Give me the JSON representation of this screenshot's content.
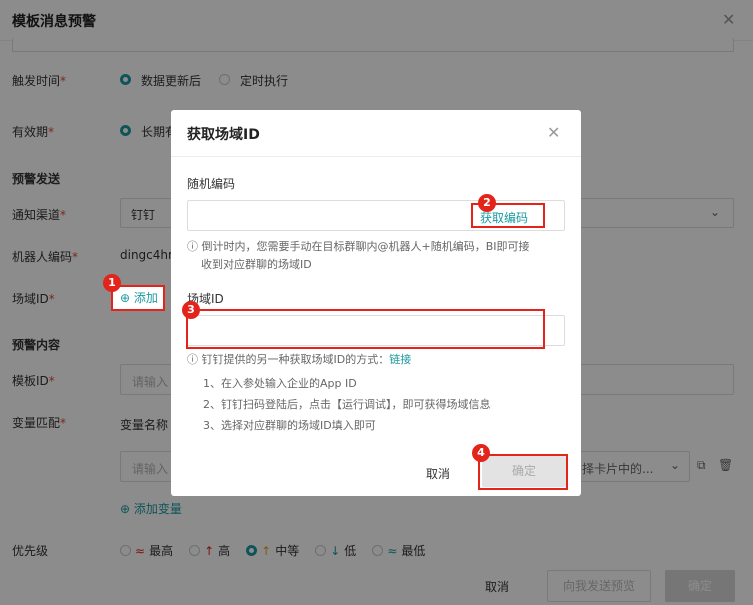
{
  "title": "模板消息预警",
  "form": {
    "trigger_label": "触发时间",
    "trigger_options": [
      "数据更新后",
      "定时执行"
    ],
    "validity_label": "有效期",
    "validity_option": "长期有",
    "section_send": "预警发送",
    "channel_label": "通知渠道",
    "channel_value": "钉钉",
    "robot_label": "机器人编码",
    "robot_value": "dingc4hm",
    "scene_label": "场域ID",
    "add_label": "添加",
    "section_content": "预警内容",
    "template_label": "模板ID",
    "template_placeholder": "请输入",
    "var_label": "变量匹配",
    "var_col_name": "变量名称",
    "var_placeholder": "请输入",
    "var_select_text": "择卡片中的...",
    "add_var_label": "添加变量",
    "priority_label": "优先级",
    "priority_options": [
      {
        "icon": "≈",
        "label": "最高"
      },
      {
        "icon": "↑",
        "label": "高"
      },
      {
        "icon": "↑",
        "label": "中等"
      },
      {
        "icon": "↓",
        "label": "低"
      },
      {
        "icon": "≈",
        "label": "最低"
      }
    ],
    "footer": {
      "cancel": "取消",
      "send_preview": "向我发送预览",
      "confirm": "确定"
    }
  },
  "dialog": {
    "title": "获取场域ID",
    "random_code_label": "随机编码",
    "get_code_label": "获取编码",
    "hint1": "倒计时内，您需要手动在目标群聊内@机器人+随机编码，BI即可接",
    "hint1b": "收到对应群聊的场域ID",
    "scene_id_label": "场域ID",
    "hint2": "钉钉提供的另一种获取场域ID的方式：",
    "hint2_link": "链接",
    "steps": [
      "1、在入参处输入企业的App ID",
      "2、钉钉扫码登陆后，点击【运行调试】，即可获得场域信息",
      "3、选择对应群聊的场域ID填入即可"
    ],
    "cancel": "取消",
    "confirm": "确定"
  },
  "badges": [
    "1",
    "2",
    "3",
    "4"
  ],
  "colors": {
    "accent": "#1b9aa0",
    "highlight": "#e3241b",
    "required": "#e0483c"
  }
}
